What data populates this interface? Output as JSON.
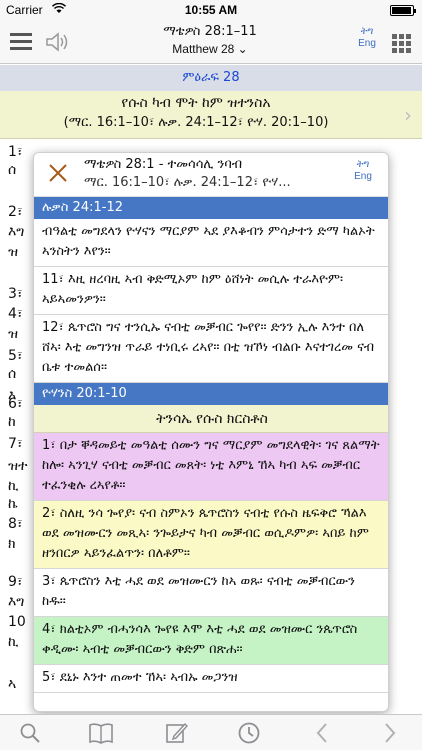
{
  "status_bar": {
    "carrier": "Carrier",
    "time": "10:55 AM"
  },
  "nav": {
    "title_geez": "ማቴዎስ 28:1–11",
    "title_en": "Matthew 28 ⌄",
    "lang_geez": "ትግ",
    "lang_en": "Eng"
  },
  "chapter_label": "ምዕራፍ  28",
  "section": {
    "title": "የሱስ ካብ ሞት ከም ዝተንስአ",
    "refs": "(ማር. 16:1–10፣ ሉቃ. 24:1–12፣ ዮሃ. 20:1–10)"
  },
  "background_verses": [
    {
      "text": "1፣"
    },
    {
      "text": "ሰ"
    },
    {
      "text": "2፣"
    },
    {
      "text": "እግ"
    },
    {
      "text": "ዝ"
    },
    {
      "text": "3፣"
    },
    {
      "text": "4፣"
    },
    {
      "text": "ዝ"
    },
    {
      "text": "5፣"
    },
    {
      "text": "ሰ"
    },
    {
      "text": "እ"
    },
    {
      "text": "6፣"
    },
    {
      "text": "ከ"
    },
    {
      "text": "7፣"
    },
    {
      "text": "ዝተ"
    },
    {
      "text": "ኪ"
    },
    {
      "text": "ኬ"
    },
    {
      "text": "8፣"
    },
    {
      "text": "ክ"
    },
    {
      "text": "9፣"
    },
    {
      "text": "እግ"
    },
    {
      "text": "10"
    },
    {
      "text": "ኪ"
    },
    {
      "text": "ኣ"
    }
  ],
  "popup": {
    "title": "ማቴዎስ 28:1 - ተመሳሳሊ ንባብ",
    "refs": "ማር. 16:1–10፣ ሉቃ. 24:1–12፣ ዮሃ...",
    "lang_geez": "ትግ",
    "lang_en": "Eng",
    "luke_head": "ሉቃስ 24:1-12",
    "luke_verses": [
      {
        "text": "ብዓልቲ መግደላን ዮሃናን ማርያም ኣደ ያእቆብን ምሳታተን ድማ ካልኦት ኣንስትን እየን።"
      },
      {
        "text": "11፣ እዚ ዘረባዚ ኣብ ቅድሚኦም ከም ዕሸነት መሲሉ ተራእዮም፡ ኣይኣመንዎን።"
      },
      {
        "text": "12፣ ጴጥሮስ ግና ተንሲኡ ናብቲ መቓብር ጐየየ። ድንን ኢሉ እንተ በለ ሸኣ፡ እቲ መግንዝ ጥራይ ተነቢሩ ረኣየ። በቲ ዝኾነ ብልቡ እናተገረመ ናብ ቤቱ ተመልሰ።"
      }
    ],
    "john_head": "ዮሃንስ 20:1-10",
    "john_section": "ትንሳኤ የሱስ ክርስቶስ",
    "john_verses": [
      {
        "text": "1፣ በታ ቐዳመይቲ መዓልቲ ሰሙን ግና ማርያም መግደላዊት፡ ገና ጸልማት ከሎ፡ ኣንጊሃ ናብቲ መቓብር መጸት፡ ነቲ እምኒ ኸኣ ካብ ኣፍ መቓብር ተፈንቂሉ ረኣየቶ።",
        "color": "pink"
      },
      {
        "text": "2፣ ስለዚ ንሳ ጐየያ፡ ናብ ስምኦን ጴጥሮስን ናብቲ የሱስ ዜፍቅሮ ኻልእ ወደ መዝሙርን መጺኣ፡ ንጐይታና ካብ መቓብር ወሲዶምዎ፡ ኣበይ ከም ዘንበርዎ ኣይንፈልጥን፡ በለቶም።",
        "color": "yellow"
      },
      {
        "text": "3፣ ጴጥሮስን እቲ ሓደ ወደ መዝሙርን ከኣ ወጹ፡ ናብቲ መቓብርውን ከዱ።",
        "color": "white"
      },
      {
        "text": "4፣ ክልቲኦም ብሓንሳእ ጐየዩ እሞ እቲ ሓደ ወደ መዝሙር ንጴጥሮስ ቀዲሙ፡ ኣብቲ መቓብርውን ቅድም በጽሐ።",
        "color": "green"
      },
      {
        "text": "5፣ ደኒኑ እንተ ጠመተ ኸኣ፡ ኣብኡ መጋንዝ",
        "color": "white"
      }
    ]
  }
}
